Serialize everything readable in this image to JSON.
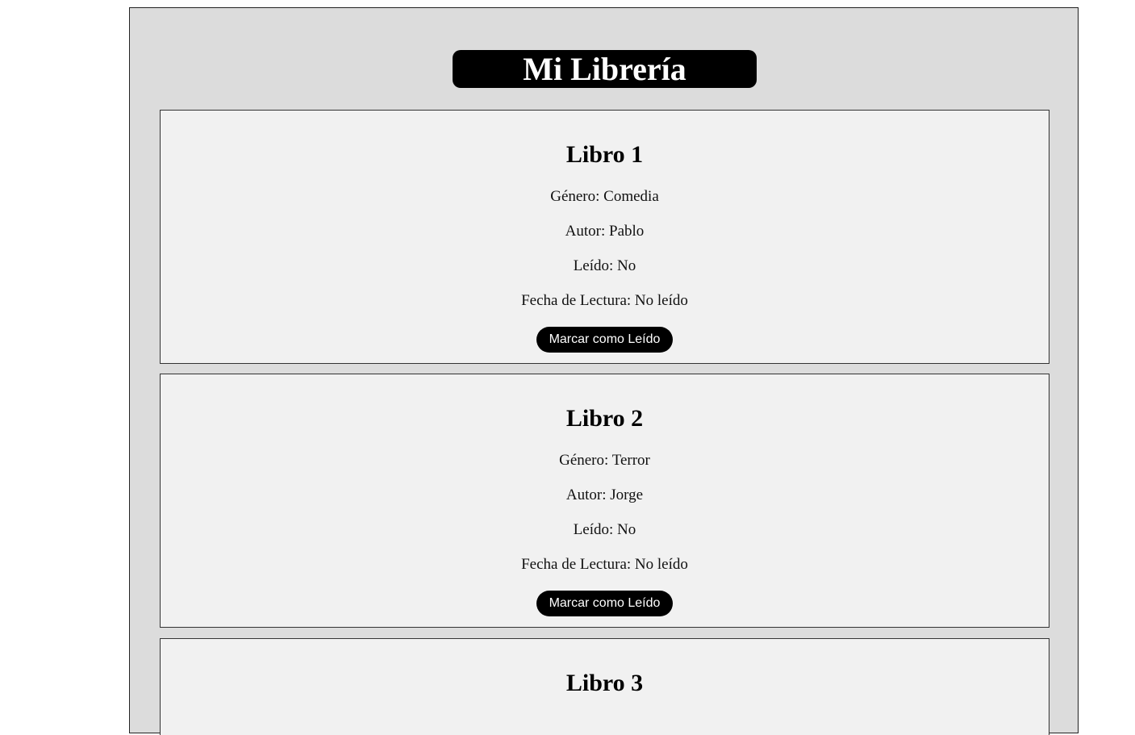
{
  "header": {
    "title": "Mi Librería"
  },
  "books": [
    {
      "title": "Libro 1",
      "genre": "Género: Comedia",
      "author": "Autor: Pablo",
      "read": "Leído: No",
      "date": "Fecha de Lectura: No leído",
      "button_label": "Marcar como Leído"
    },
    {
      "title": "Libro 2",
      "genre": "Género: Terror",
      "author": "Autor: Jorge",
      "read": "Leído: No",
      "date": "Fecha de Lectura: No leído",
      "button_label": "Marcar como Leído"
    },
    {
      "title": "Libro 3"
    }
  ],
  "colors": {
    "page_background": "#ffffff",
    "container_background": "#dcdcdc",
    "card_background": "#f1f1f1",
    "button_background": "#000000",
    "button_text": "#ffffff"
  }
}
